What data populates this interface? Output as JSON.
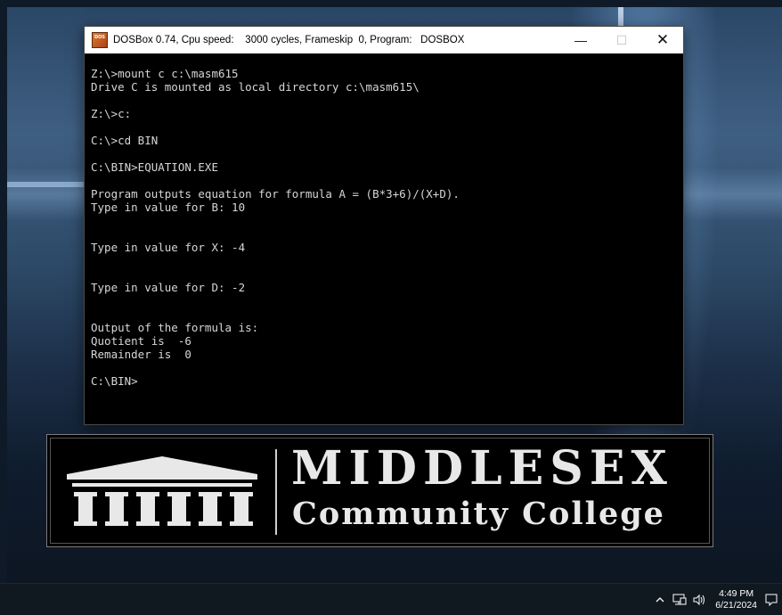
{
  "window": {
    "title": "DOSBox 0.74, Cpu speed:    3000 cycles, Frameskip  0, Program:   DOSBOX",
    "icon": "dosbox-icon",
    "minimize_label": "—",
    "maximize_label": "☐",
    "close_label": "✕"
  },
  "console": {
    "lines": [
      "Z:\\>mount c c:\\masm615",
      "Drive C is mounted as local directory c:\\masm615\\",
      "",
      "Z:\\>c:",
      "",
      "C:\\>cd BIN",
      "",
      "C:\\BIN>EQUATION.EXE",
      "",
      "Program outputs equation for formula A = (B*3+6)/(X+D).",
      "Type in value for B: 10",
      "",
      "",
      "Type in value for X: -4",
      "",
      "",
      "Type in value for D: -2",
      "",
      "",
      "Output of the formula is:",
      "Quotient is  -6",
      "Remainder is  0",
      "",
      "C:\\BIN>"
    ]
  },
  "logo": {
    "title": "MIDDLESEX",
    "subtitle": "Community College"
  },
  "taskbar": {
    "time": "4:49 PM",
    "date": "6/21/2024",
    "tray_icons": [
      "chevron-up-icon",
      "network-icon",
      "volume-icon",
      "notification-icon"
    ]
  },
  "colors": {
    "console_bg": "#000000",
    "console_text": "#d6d6d6",
    "taskbar_bg": "#101820"
  }
}
